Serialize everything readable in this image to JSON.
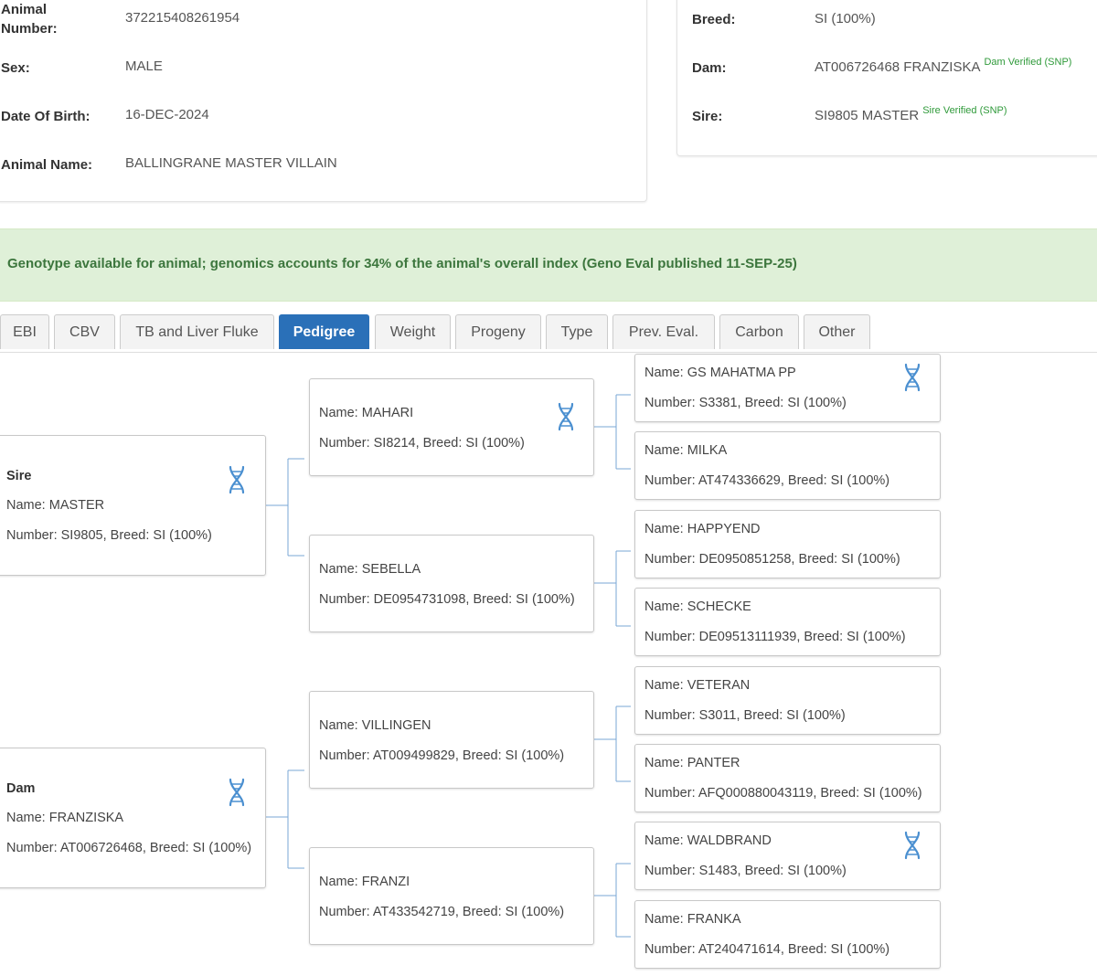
{
  "animal": {
    "number_label": "Animal Number:",
    "number_label_line1": "Animal",
    "number_label_line2": "Number:",
    "number": "372215408261954",
    "sex_label": "Sex:",
    "sex": "MALE",
    "dob_label": "Date Of Birth:",
    "dob": "16-DEC-2024",
    "name_label": "Animal Name:",
    "name": "BALLINGRANE MASTER VILLAIN",
    "breed_label": "Breed:",
    "breed": "SI (100%)",
    "dam_label": "Dam:",
    "dam": "AT006726468 FRANZISKA",
    "dam_verified": "Dam Verified (SNP)",
    "sire_label": "Sire:",
    "sire": "SI9805 MASTER",
    "sire_verified": "Sire Verified (SNP)"
  },
  "genotype_banner": "Genotype available for animal; genomics accounts for 34% of the animal's overall index (Geno Eval published 11-SEP-25)",
  "tabs": [
    {
      "label": "EBI",
      "active": false
    },
    {
      "label": "CBV",
      "active": false
    },
    {
      "label": "TB and Liver Fluke",
      "active": false
    },
    {
      "label": "Pedigree",
      "active": true
    },
    {
      "label": "Weight",
      "active": false
    },
    {
      "label": "Progeny",
      "active": false
    },
    {
      "label": "Type",
      "active": false
    },
    {
      "label": "Prev. Eval.",
      "active": false
    },
    {
      "label": "Carbon",
      "active": false
    },
    {
      "label": "Other",
      "active": false
    }
  ],
  "colors": {
    "active_tab": "#2a70b8",
    "banner_bg": "#dff0d8",
    "banner_text": "#3c763d",
    "verified": "#2f9a3a",
    "dna": "#4a8fd0"
  },
  "pedigree": {
    "sire": {
      "role": "Sire",
      "name": "Name: MASTER",
      "number": "Number: SI9805, Breed: SI (100%)",
      "genotyped": true
    },
    "dam": {
      "role": "Dam",
      "name": "Name: FRANZISKA",
      "number": "Number: AT006726468, Breed: SI (100%)",
      "genotyped": true
    },
    "sire_sire": {
      "name": "Name: MAHARI",
      "number": "Number: SI8214, Breed: SI (100%)",
      "genotyped": true
    },
    "sire_dam": {
      "name": "Name: SEBELLA",
      "number": "Number: DE0954731098, Breed: SI (100%)",
      "genotyped": false
    },
    "dam_sire": {
      "name": "Name: VILLINGEN",
      "number": "Number: AT009499829, Breed: SI (100%)",
      "genotyped": false
    },
    "dam_dam": {
      "name": "Name: FRANZI",
      "number": "Number: AT433542719, Breed: SI (100%)",
      "genotyped": false
    },
    "gg1": {
      "name": "Name: GS MAHATMA PP",
      "number": "Number: S3381, Breed: SI (100%)",
      "genotyped": true
    },
    "gg2": {
      "name": "Name: MILKA",
      "number": "Number: AT474336629, Breed: SI (100%)",
      "genotyped": false
    },
    "gg3": {
      "name": "Name: HAPPYEND",
      "number": "Number: DE0950851258, Breed: SI (100%)",
      "genotyped": false
    },
    "gg4": {
      "name": "Name: SCHECKE",
      "number": "Number: DE09513111939, Breed: SI (100%)",
      "genotyped": false
    },
    "gg5": {
      "name": "Name: VETERAN",
      "number": "Number: S3011, Breed: SI (100%)",
      "genotyped": false
    },
    "gg6": {
      "name": "Name: PANTER",
      "number": "Number: AFQ000880043119, Breed: SI (100%)",
      "genotyped": false
    },
    "gg7": {
      "name": "Name: WALDBRAND",
      "number": "Number: S1483, Breed: SI (100%)",
      "genotyped": true
    },
    "gg8": {
      "name": "Name: FRANKA",
      "number": "Number: AT240471614, Breed: SI (100%)",
      "genotyped": false
    }
  }
}
